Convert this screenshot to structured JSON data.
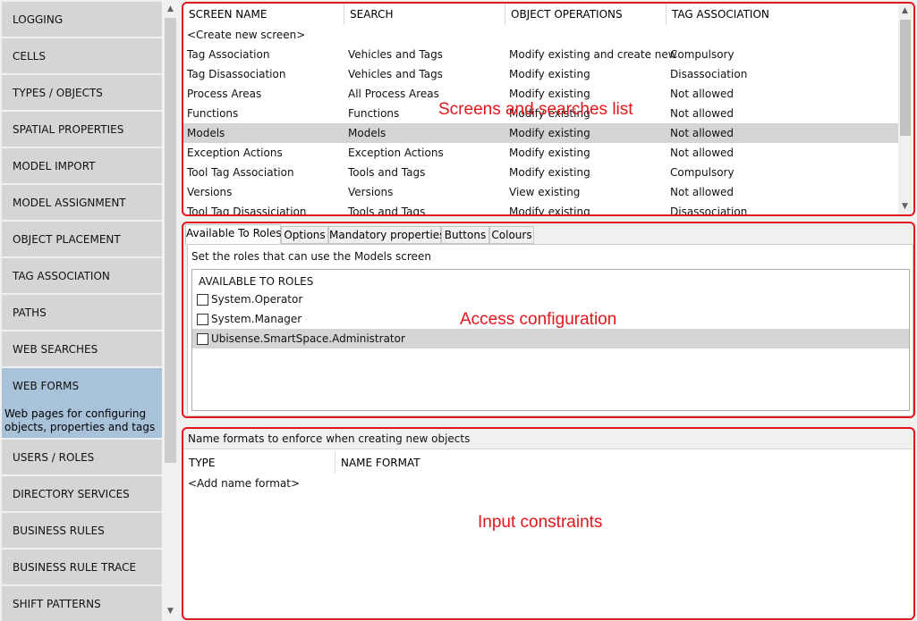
{
  "sidebar": {
    "items": [
      {
        "label": "LOGGING"
      },
      {
        "label": "CELLS"
      },
      {
        "label": "TYPES / OBJECTS"
      },
      {
        "label": "SPATIAL PROPERTIES"
      },
      {
        "label": "MODEL IMPORT"
      },
      {
        "label": "MODEL ASSIGNMENT"
      },
      {
        "label": "OBJECT PLACEMENT"
      },
      {
        "label": "TAG ASSOCIATION"
      },
      {
        "label": "PATHS"
      },
      {
        "label": "WEB SEARCHES"
      },
      {
        "label": "WEB FORMS",
        "description": "Web pages for configuring objects, properties and tags"
      },
      {
        "label": "USERS / ROLES"
      },
      {
        "label": "DIRECTORY SERVICES"
      },
      {
        "label": "BUSINESS RULES"
      },
      {
        "label": "BUSINESS RULE TRACE"
      },
      {
        "label": "SHIFT PATTERNS"
      }
    ],
    "scroll_up_icon": "chevron-up-icon",
    "scroll_down_icon": "chevron-down-icon"
  },
  "screens": {
    "headers": [
      "SCREEN NAME",
      "SEARCH",
      "OBJECT OPERATIONS",
      "TAG ASSOCIATION"
    ],
    "create_new": "<Create new screen>",
    "rows": [
      [
        "Tag Association",
        "Vehicles and Tags",
        "Modify existing and create new",
        "Compulsory"
      ],
      [
        "Tag Disassociation",
        "Vehicles and Tags",
        "Modify existing",
        "Disassociation"
      ],
      [
        "Process Areas",
        "All Process Areas",
        "Modify existing",
        "Not allowed"
      ],
      [
        "Functions",
        "Functions",
        "Modify existing",
        "Not allowed"
      ],
      [
        "Models",
        "Models",
        "Modify existing",
        "Not allowed"
      ],
      [
        "Exception Actions",
        "Exception Actions",
        "Modify existing",
        "Not allowed"
      ],
      [
        "Tool Tag Association",
        "Tools and Tags",
        "Modify existing",
        "Compulsory"
      ],
      [
        "Versions",
        "Versions",
        "View existing",
        "Not allowed"
      ],
      [
        "Tool Tag Disassiciation",
        "Tools and Tags",
        "Modify existing",
        "Disassociation"
      ]
    ],
    "selected_row": 4
  },
  "tabs": {
    "items": [
      "Available To Roles",
      "Options",
      "Mandatory properties",
      "Buttons",
      "Colours"
    ],
    "active": 0,
    "instruction": "Set the roles that can use the Models screen",
    "roles_header": "AVAILABLE TO ROLES",
    "roles": [
      {
        "name": "System.Operator",
        "checked": false
      },
      {
        "name": "System.Manager",
        "checked": false
      },
      {
        "name": "Ubisense.SmartSpace.Administrator",
        "checked": false
      }
    ]
  },
  "formats": {
    "title": "Name formats to enforce when creating new objects",
    "headers": [
      "TYPE",
      "NAME FORMAT"
    ],
    "add_new": "<Add name format>"
  },
  "annotations": {
    "screens": "Screens and searches list",
    "access": "Access configuration",
    "input": "Input constraints",
    "color": "#e2161b"
  }
}
